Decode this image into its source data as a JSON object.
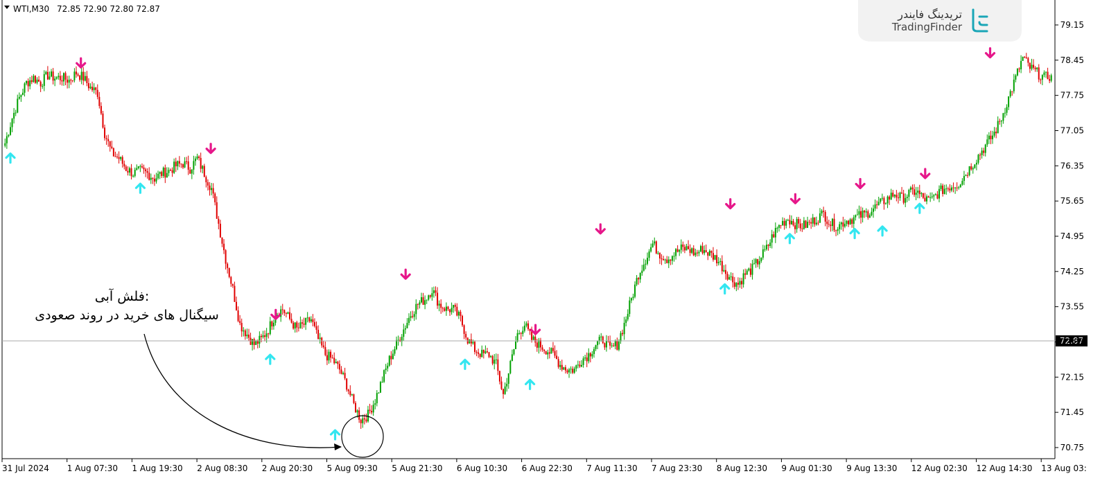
{
  "header": {
    "symbol": "WTI,M30",
    "ohlc": "72.85 72.90 72.80 72.87"
  },
  "logo": {
    "name_fa": "تریدینگ فایندر",
    "name_en": "TradingFinder"
  },
  "annotation": {
    "line1": "فلش آبی:",
    "line2": "سیگنال های خرید در روند صعودی"
  },
  "colors": {
    "bull": "#00a000",
    "bear": "#e00000",
    "buy_arrow": "#33e6f0",
    "sell_arrow": "#e6178a",
    "price_line": "#aaaaaa",
    "price_box": "#000000"
  },
  "chart_data": {
    "type": "candlestick",
    "ylim": [
      70.5,
      79.5
    ],
    "y_ticks": [
      "79.15",
      "78.45",
      "77.75",
      "77.05",
      "76.35",
      "75.65",
      "74.95",
      "74.25",
      "73.55",
      "72.85",
      "72.15",
      "71.45",
      "70.75"
    ],
    "current_price": "72.87",
    "x_ticks": [
      "31 Jul 2024",
      "1 Aug 07:30",
      "1 Aug 19:30",
      "2 Aug 08:30",
      "2 Aug 20:30",
      "5 Aug 09:30",
      "5 Aug 21:30",
      "6 Aug 10:30",
      "6 Aug 22:30",
      "7 Aug 11:30",
      "7 Aug 23:30",
      "8 Aug 12:30",
      "9 Aug 01:30",
      "9 Aug 13:30",
      "12 Aug 02:30",
      "12 Aug 14:30",
      "13 Aug 03:"
    ],
    "close_path": [
      76.8,
      77.3,
      77.7,
      78.0,
      78.1,
      78.0,
      78.15,
      78.1,
      78.1,
      78.05,
      78.2,
      78.1,
      77.9,
      77.8,
      77.0,
      76.6,
      76.5,
      76.3,
      76.2,
      76.25,
      76.2,
      76.1,
      76.2,
      76.25,
      76.35,
      76.4,
      76.3,
      76.5,
      76.2,
      75.9,
      75.2,
      74.5,
      73.9,
      73.2,
      73.0,
      72.8,
      72.9,
      73.1,
      73.4,
      73.5,
      73.3,
      73.1,
      73.2,
      73.3,
      72.9,
      72.6,
      72.5,
      72.3,
      72.0,
      71.6,
      71.3,
      71.4,
      71.7,
      72.1,
      72.5,
      72.8,
      73.1,
      73.4,
      73.6,
      73.7,
      73.9,
      73.6,
      73.5,
      73.5,
      73.3,
      72.9,
      72.7,
      72.6,
      72.6,
      72.4,
      71.8,
      72.4,
      73.0,
      73.2,
      72.9,
      72.8,
      72.7,
      72.6,
      72.4,
      72.3,
      72.3,
      72.5,
      72.6,
      72.8,
      72.9,
      72.7,
      72.8,
      73.2,
      73.7,
      74.2,
      74.5,
      74.8,
      74.6,
      74.5,
      74.6,
      74.7,
      74.7,
      74.6,
      74.7,
      74.6,
      74.5,
      74.3,
      74.1,
      74.0,
      74.2,
      74.3,
      74.5,
      74.7,
      75.0,
      75.2,
      75.3,
      75.2,
      75.15,
      75.2,
      75.3,
      75.4,
      75.2,
      75.15,
      75.25,
      75.3,
      75.35,
      75.4,
      75.5,
      75.6,
      75.7,
      75.8,
      75.7,
      75.8,
      75.85,
      75.7,
      75.65,
      75.8,
      75.9,
      75.95,
      76.0,
      76.2,
      76.4,
      76.6,
      76.8,
      77.0,
      77.3,
      77.7,
      78.1,
      78.5,
      78.3,
      78.2,
      78.1,
      78.15
    ],
    "buy_signals": [
      {
        "t": "31 Jul 2024",
        "price": 76.8
      },
      {
        "t": "1 Aug 19:30",
        "price": 76.2
      },
      {
        "t": "2 Aug 20:30",
        "price": 72.8
      },
      {
        "t": "5 Aug 09:30",
        "price": 71.3
      },
      {
        "t": "6 Aug 10:30",
        "price": 72.7
      },
      {
        "t": "6 Aug 22:30",
        "price": 72.3
      },
      {
        "t": "8 Aug 12:30",
        "price": 74.2
      },
      {
        "t": "9 Aug 01:30",
        "price": 75.2
      },
      {
        "t": "9 Aug 13:30",
        "price": 75.3
      },
      {
        "t": "9 Aug 13:30",
        "price": 75.35
      },
      {
        "t": "12 Aug 02:30",
        "price": 75.8
      }
    ],
    "sell_signals": [
      {
        "t": "1 Aug 07:30",
        "price": 78.1
      },
      {
        "t": "2 Aug 08:30",
        "price": 76.4
      },
      {
        "t": "2 Aug 20:30",
        "price": 73.1
      },
      {
        "t": "5 Aug 21:30",
        "price": 73.9
      },
      {
        "t": "6 Aug 22:30",
        "price": 72.8
      },
      {
        "t": "7 Aug 11:30",
        "price": 74.8
      },
      {
        "t": "8 Aug 12:30",
        "price": 75.3
      },
      {
        "t": "9 Aug 01:30",
        "price": 75.4
      },
      {
        "t": "9 Aug 13:30",
        "price": 75.7
      },
      {
        "t": "12 Aug 02:30",
        "price": 75.9
      },
      {
        "t": "12 Aug 14:30",
        "price": 78.3
      }
    ]
  }
}
